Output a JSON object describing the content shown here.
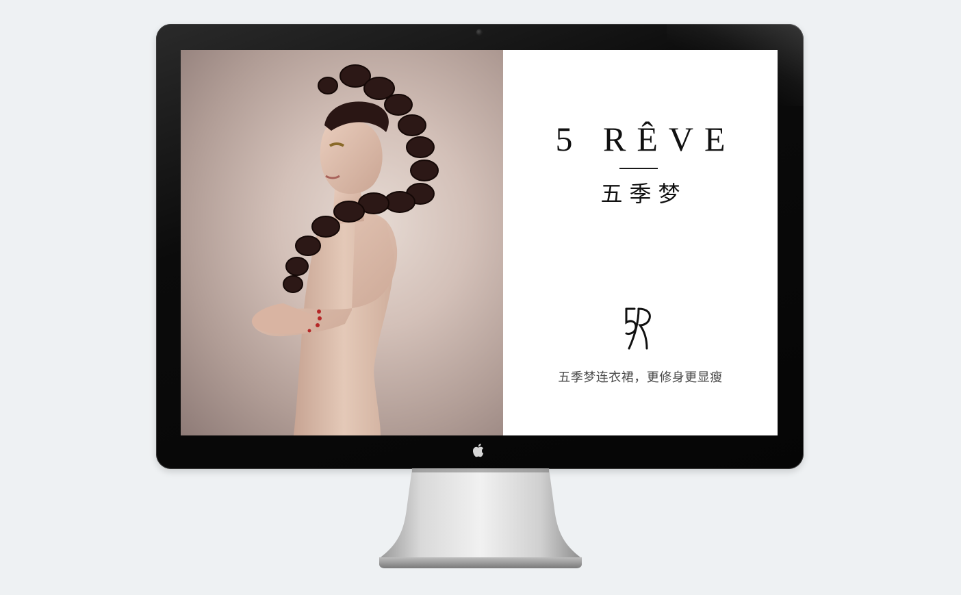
{
  "brand": {
    "name_latin": "5 RÊVE",
    "name_cn": "五季梦"
  },
  "tagline": "五季梦连衣裙，更修身更显瘦",
  "icons": {
    "logo_mark": "5r-monogram-icon",
    "apple": "apple-logo-icon"
  },
  "colors": {
    "panel_background": "#ffffff",
    "text_primary": "#111111",
    "text_secondary": "#4a4a4a",
    "bezel": "#0b0b0b",
    "photo_background": "#c8b4ac"
  }
}
